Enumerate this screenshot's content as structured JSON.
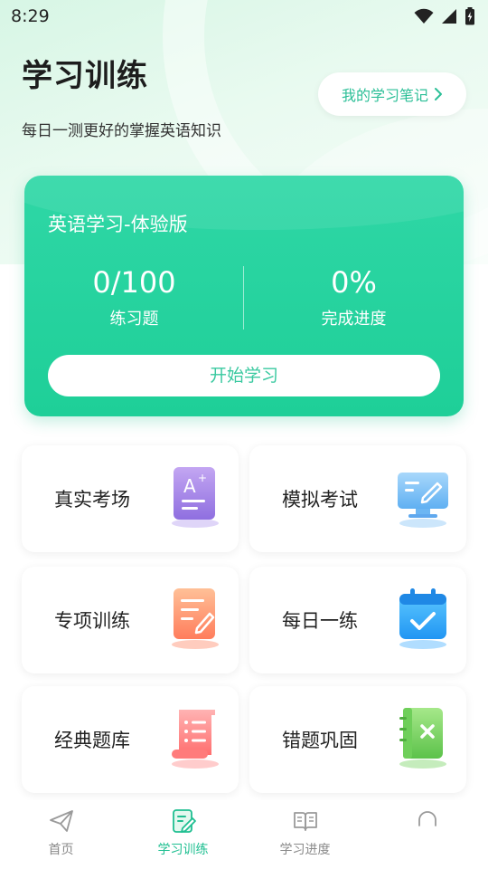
{
  "status_bar": {
    "time": "8:29"
  },
  "header": {
    "title": "学习训练",
    "subtitle": "每日一测更好的掌握英语知识",
    "notes_button": "我的学习笔记"
  },
  "course_card": {
    "title": "英语学习-体验版",
    "practice_count": "0/100",
    "practice_label": "练习题",
    "progress_value": "0%",
    "progress_label": "完成进度",
    "start_button": "开始学习"
  },
  "tiles": [
    {
      "label": "真实考场",
      "icon": "exam-paper-icon"
    },
    {
      "label": "模拟考试",
      "icon": "monitor-edit-icon"
    },
    {
      "label": "专项训练",
      "icon": "document-edit-icon"
    },
    {
      "label": "每日一练",
      "icon": "calendar-check-icon"
    },
    {
      "label": "经典题库",
      "icon": "scroll-list-icon"
    },
    {
      "label": "错题巩固",
      "icon": "notebook-x-icon"
    }
  ],
  "tab_bar": {
    "items": [
      {
        "label": "首页",
        "icon": "paper-plane-icon",
        "active": false
      },
      {
        "label": "学习训练",
        "icon": "edit-note-icon",
        "active": true
      },
      {
        "label": "学习进度",
        "icon": "open-book-icon",
        "active": false
      },
      {
        "label": "",
        "icon": "headset-icon",
        "active": false
      }
    ]
  },
  "colors": {
    "accent": "#1fcf98",
    "accent_text": "#2bbf97",
    "inactive_tab": "#8a8a8a"
  }
}
